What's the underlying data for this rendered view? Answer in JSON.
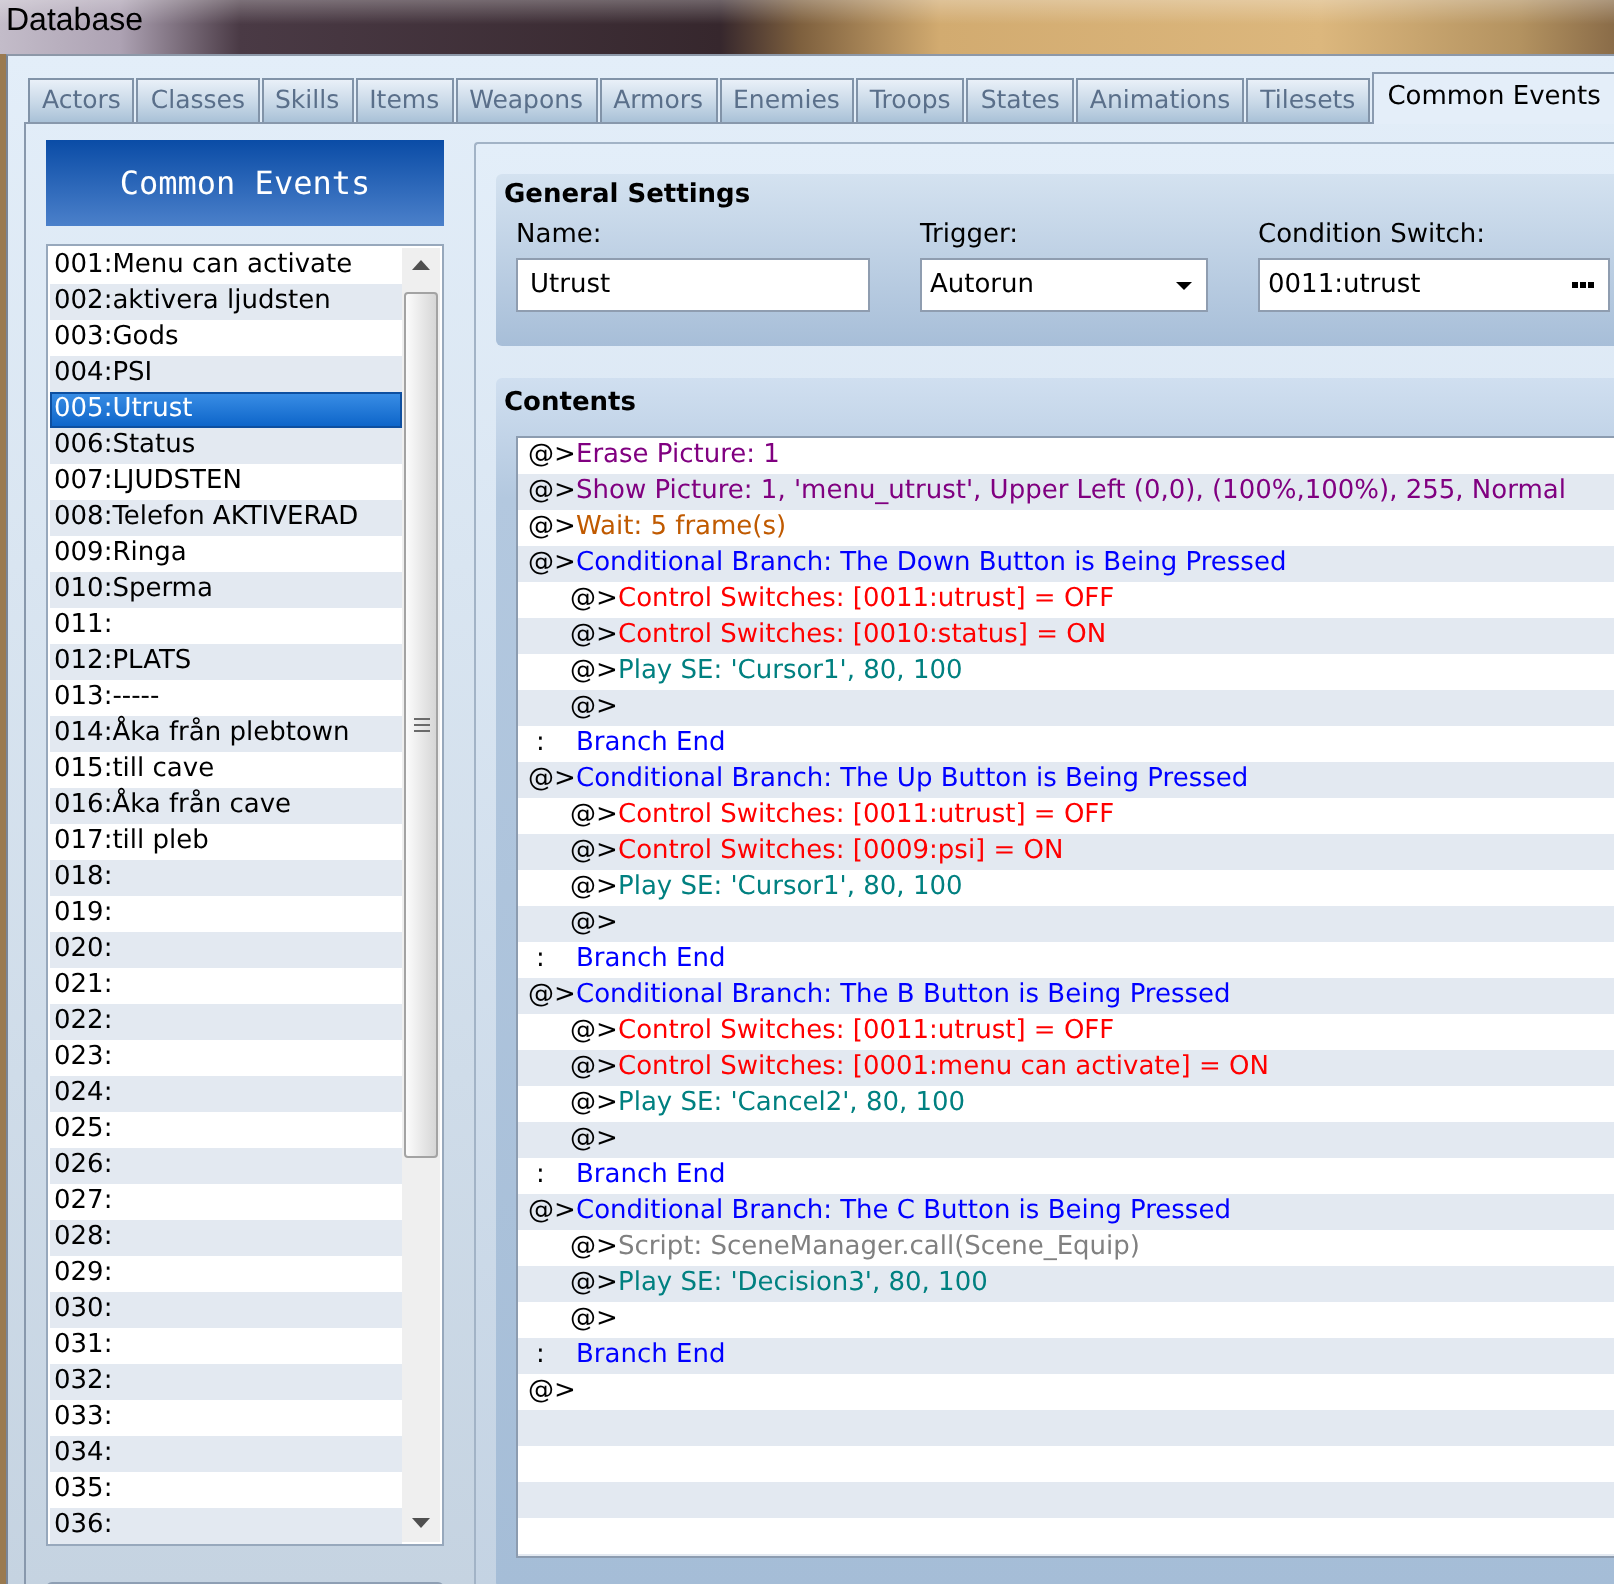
{
  "window": {
    "title": "Database"
  },
  "tabs": [
    {
      "label": "Actors",
      "selected": false
    },
    {
      "label": "Classes",
      "selected": false
    },
    {
      "label": "Skills",
      "selected": false
    },
    {
      "label": "Items",
      "selected": false
    },
    {
      "label": "Weapons",
      "selected": false
    },
    {
      "label": "Armors",
      "selected": false
    },
    {
      "label": "Enemies",
      "selected": false
    },
    {
      "label": "Troops",
      "selected": false
    },
    {
      "label": "States",
      "selected": false
    },
    {
      "label": "Animations",
      "selected": false
    },
    {
      "label": "Tilesets",
      "selected": false
    },
    {
      "label": "Common Events",
      "selected": true
    }
  ],
  "event_list": {
    "title": "Common Events",
    "items": [
      {
        "label": "001:Menu can activate",
        "selected": false
      },
      {
        "label": "002:aktivera ljudsten",
        "selected": false
      },
      {
        "label": "003:Gods",
        "selected": false
      },
      {
        "label": "004:PSI",
        "selected": false
      },
      {
        "label": "005:Utrust",
        "selected": true
      },
      {
        "label": "006:Status",
        "selected": false
      },
      {
        "label": "007:LJUDSTEN",
        "selected": false
      },
      {
        "label": "008:Telefon AKTIVERAD",
        "selected": false
      },
      {
        "label": "009:Ringa",
        "selected": false
      },
      {
        "label": "010:Sperma",
        "selected": false
      },
      {
        "label": "011:",
        "selected": false
      },
      {
        "label": "012:PLATS",
        "selected": false
      },
      {
        "label": "013:-----",
        "selected": false
      },
      {
        "label": "014:Åka från plebtown",
        "selected": false
      },
      {
        "label": "015:till cave",
        "selected": false
      },
      {
        "label": "016:Åka från cave",
        "selected": false
      },
      {
        "label": "017:till pleb",
        "selected": false
      },
      {
        "label": "018:",
        "selected": false
      },
      {
        "label": "019:",
        "selected": false
      },
      {
        "label": "020:",
        "selected": false
      },
      {
        "label": "021:",
        "selected": false
      },
      {
        "label": "022:",
        "selected": false
      },
      {
        "label": "023:",
        "selected": false
      },
      {
        "label": "024:",
        "selected": false
      },
      {
        "label": "025:",
        "selected": false
      },
      {
        "label": "026:",
        "selected": false
      },
      {
        "label": "027:",
        "selected": false
      },
      {
        "label": "028:",
        "selected": false
      },
      {
        "label": "029:",
        "selected": false
      },
      {
        "label": "030:",
        "selected": false
      },
      {
        "label": "031:",
        "selected": false
      },
      {
        "label": "032:",
        "selected": false
      },
      {
        "label": "033:",
        "selected": false
      },
      {
        "label": "034:",
        "selected": false
      },
      {
        "label": "035:",
        "selected": false
      },
      {
        "label": "036:",
        "selected": false
      }
    ]
  },
  "general_settings": {
    "title": "General Settings",
    "name": {
      "label": "Name:",
      "value": "Utrust"
    },
    "trigger": {
      "label": "Trigger:",
      "value": "Autorun"
    },
    "condition_switch": {
      "label": "Condition Switch:",
      "value": "0011:utrust"
    }
  },
  "contents": {
    "title": "Contents",
    "commands": [
      {
        "marker": "@>",
        "kind": "picture",
        "text": "Erase Picture: 1"
      },
      {
        "marker": "@>",
        "kind": "picture",
        "text": "Show Picture: 1, 'menu_utrust', Upper Left (0,0), (100%,100%), 255, Normal"
      },
      {
        "marker": "@>",
        "kind": "wait",
        "text": "Wait: 5 frame(s)"
      },
      {
        "marker": "@>",
        "kind": "branch",
        "text": "Conditional Branch: The Down Button is Being Pressed",
        "children": [
          {
            "marker": "@>",
            "kind": "switch",
            "text": "Control Switches: [0011:utrust] = OFF"
          },
          {
            "marker": "@>",
            "kind": "switch",
            "text": "Control Switches: [0010:status] = ON"
          },
          {
            "marker": "@>",
            "kind": "sound",
            "text": "Play SE: 'Cursor1', 80, 100"
          },
          {
            "marker": "@>",
            "kind": "empty"
          }
        ]
      },
      {
        "marker": ":",
        "kind": "branch_end",
        "text": "Branch End"
      },
      {
        "marker": "@>",
        "kind": "branch",
        "text": "Conditional Branch: The Up Button is Being Pressed",
        "children": [
          {
            "marker": "@>",
            "kind": "switch",
            "text": "Control Switches: [0011:utrust] = OFF"
          },
          {
            "marker": "@>",
            "kind": "switch",
            "text": "Control Switches: [0009:psi] = ON"
          },
          {
            "marker": "@>",
            "kind": "sound",
            "text": "Play SE: 'Cursor1', 80, 100"
          },
          {
            "marker": "@>",
            "kind": "empty"
          }
        ]
      },
      {
        "marker": ":",
        "kind": "branch_end",
        "text": "Branch End"
      },
      {
        "marker": "@>",
        "kind": "branch",
        "text": "Conditional Branch: The B Button is Being Pressed",
        "children": [
          {
            "marker": "@>",
            "kind": "switch",
            "text": "Control Switches: [0011:utrust] = OFF"
          },
          {
            "marker": "@>",
            "kind": "switch",
            "text": "Control Switches: [0001:menu can activate] = ON"
          },
          {
            "marker": "@>",
            "kind": "sound",
            "text": "Play SE: 'Cancel2', 80, 100"
          },
          {
            "marker": "@>",
            "kind": "empty"
          }
        ]
      },
      {
        "marker": ":",
        "kind": "branch_end",
        "text": "Branch End"
      },
      {
        "marker": "@>",
        "kind": "branch",
        "text": "Conditional Branch: The C Button is Being Pressed",
        "children": [
          {
            "marker": "@>",
            "kind": "script",
            "text": "Script: SceneManager.call(Scene_Equip)"
          },
          {
            "marker": "@>",
            "kind": "sound",
            "text": "Play SE: 'Decision3', 80, 100"
          },
          {
            "marker": "@>",
            "kind": "empty"
          }
        ]
      },
      {
        "marker": ":",
        "kind": "branch_end",
        "text": "Branch End"
      },
      {
        "marker": "@>",
        "kind": "empty"
      }
    ]
  }
}
